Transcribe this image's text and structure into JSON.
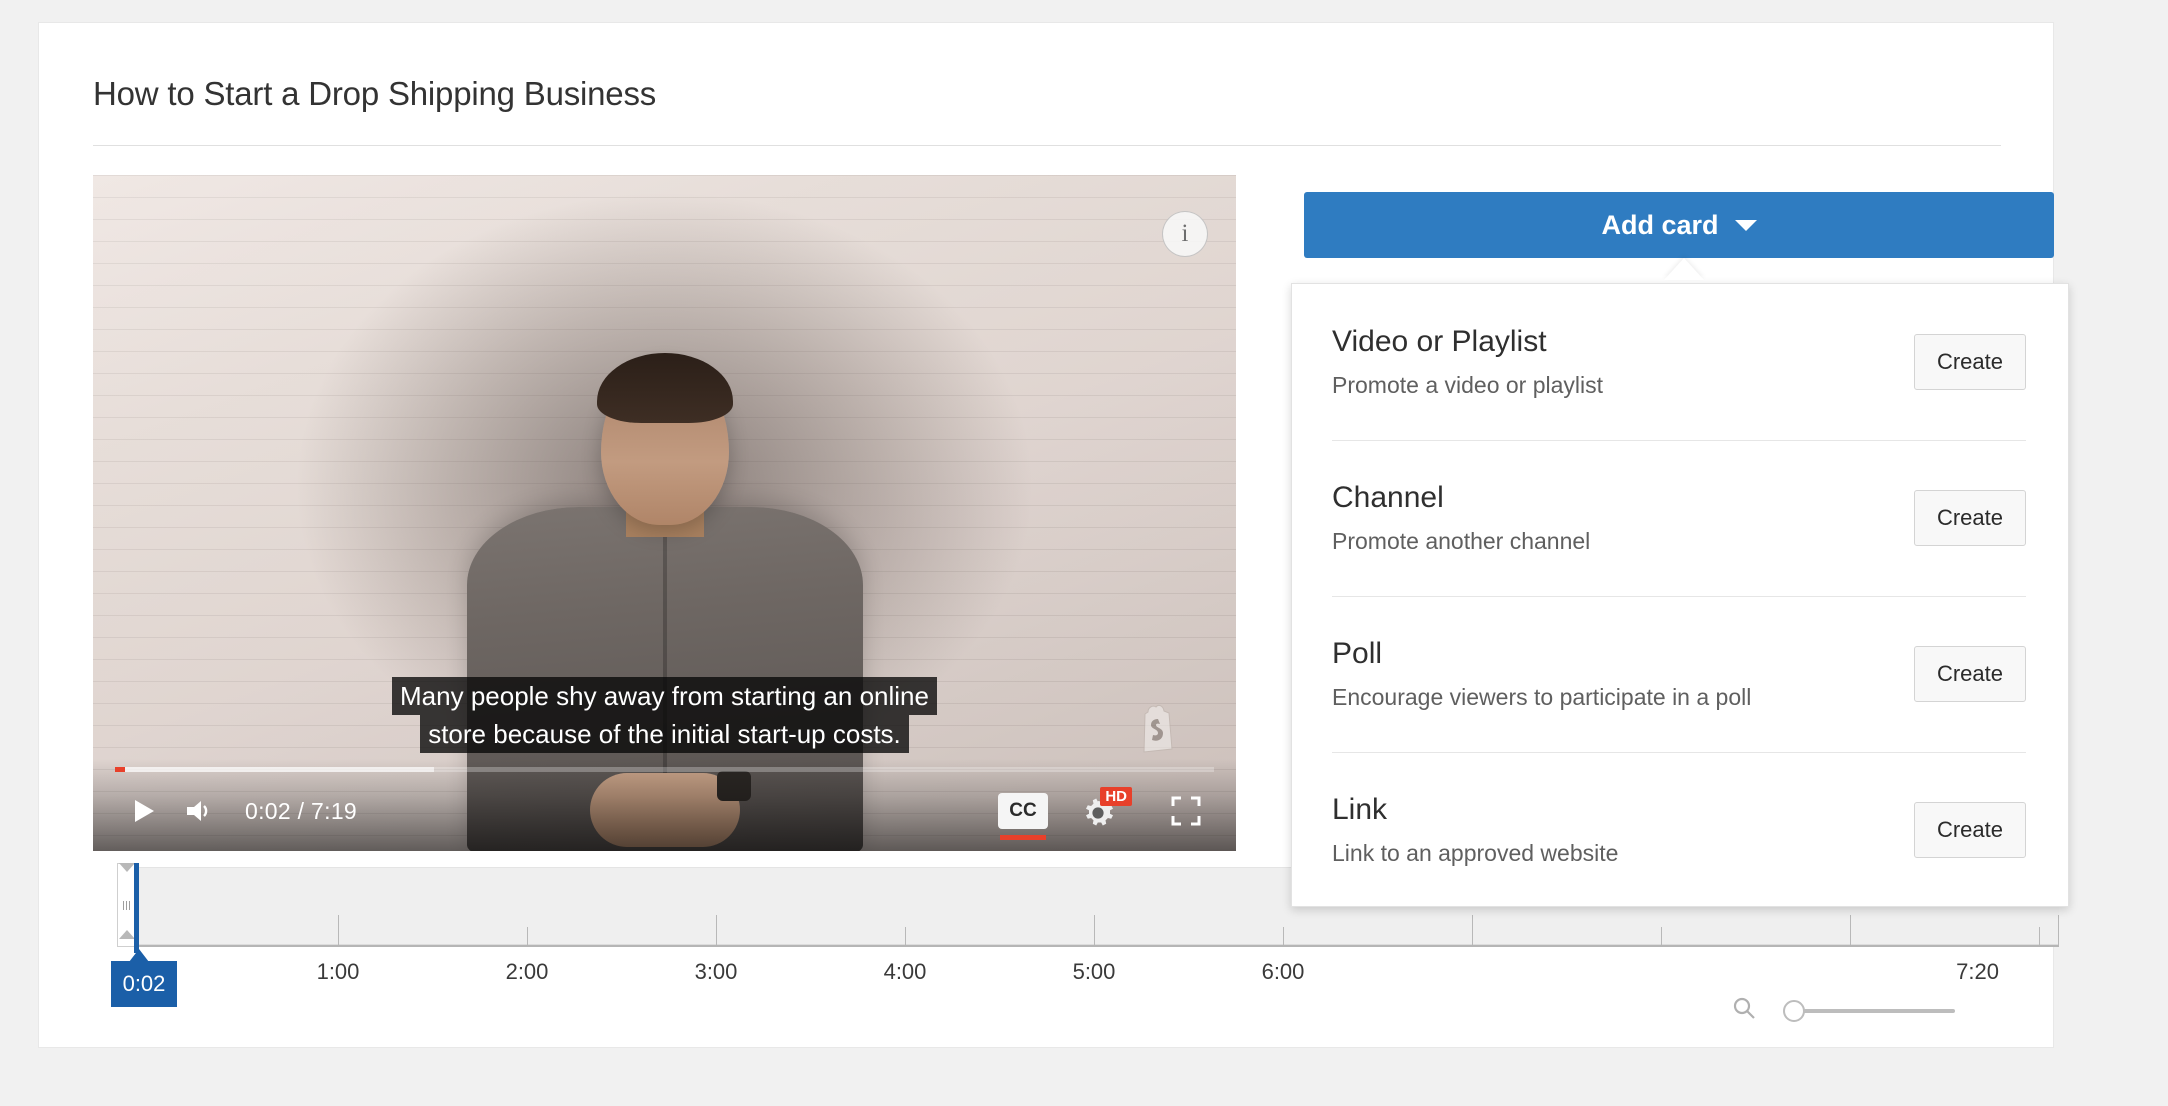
{
  "page": {
    "title": "How to Start a Drop Shipping Business",
    "background_color": "#f1f1f1",
    "card_background": "#ffffff"
  },
  "player": {
    "info_icon": "info-icon",
    "watermark": "shopify-logo-watermark",
    "caption_line_1": "Many people shy away from starting an online",
    "caption_line_2": "store because of the initial start-up costs.",
    "play_icon": "play-icon",
    "volume_icon": "volume-icon",
    "time_display": "0:02 / 7:19",
    "current_time": "0:02",
    "total_time": "7:19",
    "captions_label": "CC",
    "captions_icon": "closed-captions-icon",
    "settings_icon": "gear-icon",
    "quality_badge": "HD",
    "fullscreen_icon": "fullscreen-icon",
    "progress_percent": 0.9,
    "buffer_percent": 29,
    "progress_color": "#e8402a",
    "accent_color": "#e8402a"
  },
  "add_card": {
    "label": "Add card",
    "caret_icon": "chevron-down-icon",
    "button_color": "#2f7cc1",
    "items": [
      {
        "title": "Video or Playlist",
        "subtitle": "Promote a video or playlist",
        "action_label": "Create"
      },
      {
        "title": "Channel",
        "subtitle": "Promote another channel",
        "action_label": "Create"
      },
      {
        "title": "Poll",
        "subtitle": "Encourage viewers to participate in a poll",
        "action_label": "Create"
      },
      {
        "title": "Link",
        "subtitle": "Link to an approved website",
        "action_label": "Create"
      }
    ]
  },
  "timeline": {
    "playhead_time": "0:02",
    "playhead_color": "#1b5fa8",
    "end_time": "7:20",
    "tick_labels": [
      "1:00",
      "2:00",
      "3:00",
      "4:00",
      "5:00",
      "6:00"
    ],
    "zoom_icon": "search-icon",
    "zoom_value": 0
  }
}
